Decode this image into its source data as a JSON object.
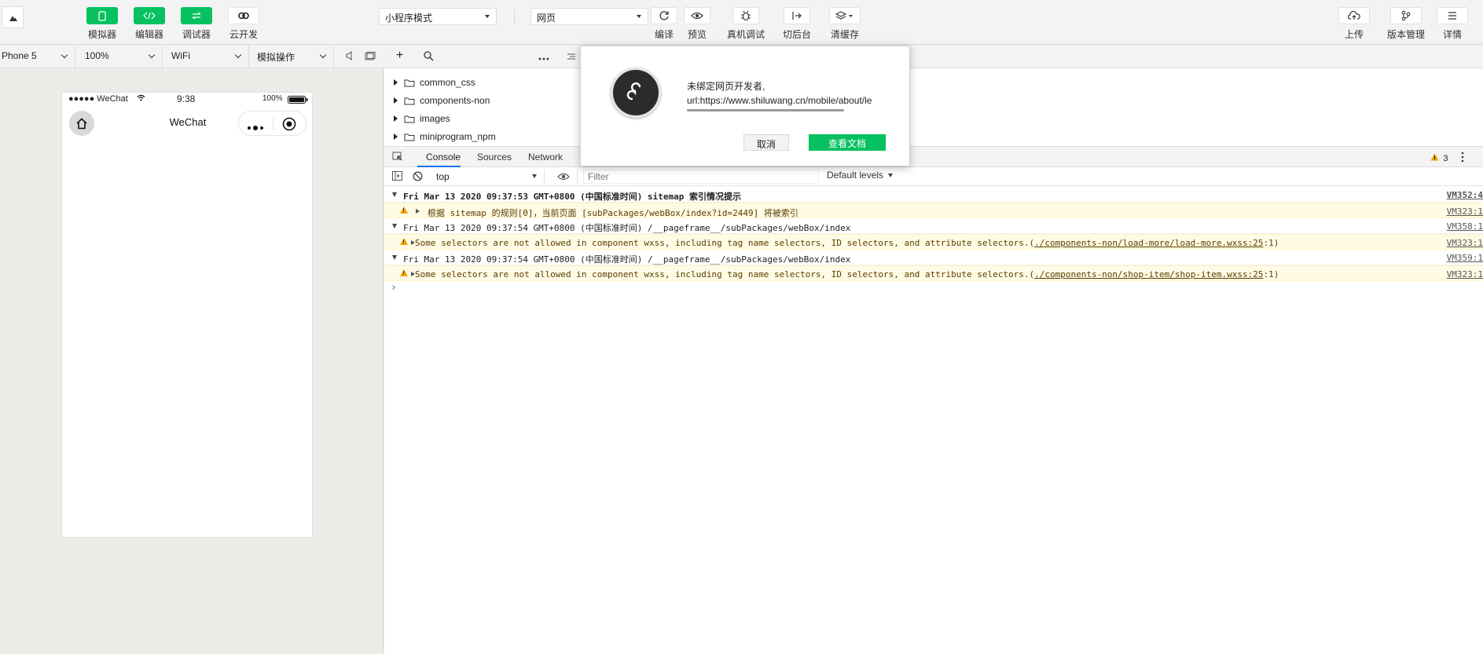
{
  "toolbar": {
    "simulator_label": "模拟器",
    "editor_label": "编辑器",
    "debugger_label": "调试器",
    "cloud_label": "云开发",
    "mode_select": "小程序模式",
    "compile_select": "网页",
    "compile_label": "编译",
    "preview_label": "预览",
    "realdevice_label": "真机调试",
    "background_label": "切后台",
    "clearcache_label": "清缓存",
    "upload_label": "上传",
    "version_label": "版本管理",
    "details_label": "详情"
  },
  "sim_bar": {
    "device": "Phone 5",
    "zoom": "100%",
    "network": "WiFi",
    "operation": "模拟操作"
  },
  "phone": {
    "signal": "●●●●● WeChat",
    "time": "9:38",
    "battery": "100%",
    "title": "WeChat"
  },
  "file_tree": [
    {
      "name": "common_css"
    },
    {
      "name": "components-non"
    },
    {
      "name": "images"
    },
    {
      "name": "miniprogram_npm"
    }
  ],
  "devtools": {
    "tabs": [
      "Console",
      "Sources",
      "Network"
    ],
    "warning_count": "3",
    "context": "top",
    "filter_placeholder": "Filter",
    "levels": "Default levels"
  },
  "console": {
    "lines": [
      {
        "text": "Fri Mar 13 2020 09:37:53 GMT+0800 (中国标准时间) sitemap 索引情况提示",
        "src": "VM352:4"
      },
      {
        "text": "根据 sitemap 的规则[0]，当前页面 [subPackages/webBox/index?id=2449] 将被索引",
        "src": "VM323:1"
      },
      {
        "text": "Fri Mar 13 2020 09:37:54 GMT+0800 (中国标准时间) /__pageframe__/subPackages/webBox/index",
        "src": "VM358:1"
      },
      {
        "text_pre": "Some selectors are not allowed in component wxss, including tag name selectors, ID selectors, and attribute selectors.(",
        "link": "./components-non/load-more/load-more.wxss:25",
        "text_post": ":1)",
        "src": "VM323:1"
      },
      {
        "text": "Fri Mar 13 2020 09:37:54 GMT+0800 (中国标准时间) /__pageframe__/subPackages/webBox/index",
        "src": "VM359:1"
      },
      {
        "text_pre": "Some selectors are not allowed in component wxss, including tag name selectors, ID selectors, and attribute selectors.(",
        "link": "./components-non/shop-item/shop-item.wxss:25",
        "text_post": ":1)",
        "src": "VM323:1"
      }
    ],
    "prompt": "›"
  },
  "dialog": {
    "title": "未绑定网页开发者,",
    "url": "url:https://www.shiluwang.cn/mobile/about/le",
    "cancel_label": "取消",
    "doc_label": "查看文档"
  },
  "colors": {
    "brand_green": "#07c160",
    "warning": "#f0a400",
    "link_blue": "#1a73e8"
  }
}
